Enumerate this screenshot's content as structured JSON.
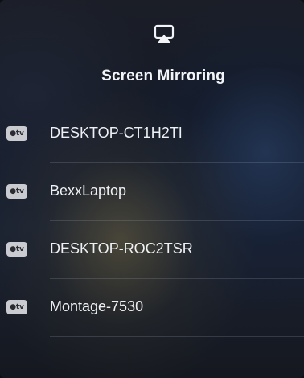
{
  "header": {
    "icon": "airplay-icon",
    "title": "Screen Mirroring"
  },
  "devices": [
    {
      "name": "DESKTOP-CT1H2TI",
      "badge": "●tv",
      "icon": "apple-tv-icon"
    },
    {
      "name": "BexxLaptop",
      "badge": "●tv",
      "icon": "apple-tv-icon"
    },
    {
      "name": "DESKTOP-ROC2TSR",
      "badge": "●tv",
      "icon": "apple-tv-icon"
    },
    {
      "name": "Montage-7530",
      "badge": "●tv",
      "icon": "apple-tv-icon"
    }
  ]
}
